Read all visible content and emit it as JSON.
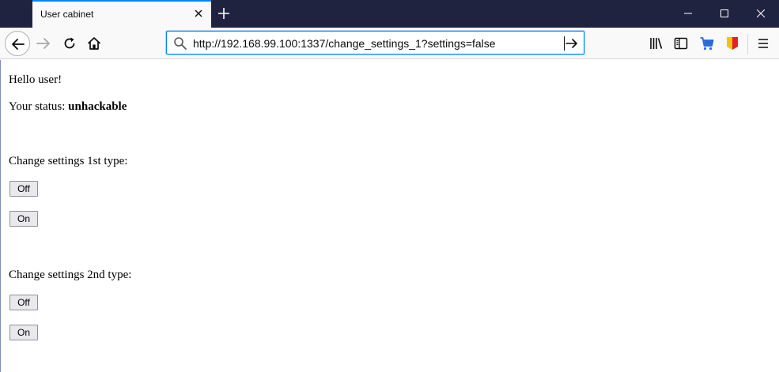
{
  "browser": {
    "tab_title": "User cabinet",
    "url": "http://192.168.99.100:1337/change_settings_1?settings=false"
  },
  "page": {
    "greeting": "Hello user!",
    "status_label": "Your status: ",
    "status_value": "unhackable",
    "section1_heading": "Change settings 1st type:",
    "section1_off": "Off",
    "section1_on": "On",
    "section2_heading": "Change settings 2nd type:",
    "section2_off": "Off",
    "section2_on": "On"
  },
  "icons": {
    "toolbar": [
      "library-icon",
      "sidebar-icon",
      "cart-icon",
      "flag-icon",
      "hamburger-menu-icon"
    ]
  },
  "colors": {
    "titlebar": "#202340",
    "accent": "#0a84ff",
    "cart": "#2a6ad9",
    "flag_yellow": "#f5c400",
    "flag_red": "#e0202a"
  }
}
